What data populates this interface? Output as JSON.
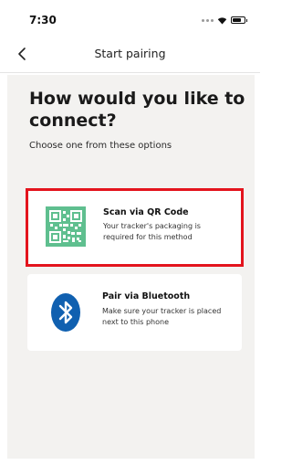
{
  "status_bar": {
    "time": "7:30"
  },
  "nav": {
    "title": "Start pairing"
  },
  "main": {
    "heading": "How would you like to connect?",
    "subheading": "Choose one from these options",
    "options": [
      {
        "title": "Scan via QR Code",
        "description": "Your tracker's packaging is required for this method",
        "icon": "qr-code-icon",
        "selected": true
      },
      {
        "title": "Pair via Bluetooth",
        "description": "Make sure your tracker is placed next to this phone",
        "icon": "bluetooth-icon",
        "selected": false
      }
    ]
  },
  "colors": {
    "highlight": "#e3141d",
    "qr_green": "#5fbf8f",
    "bluetooth_blue": "#1060b0",
    "content_bg": "#f3f2f0"
  }
}
